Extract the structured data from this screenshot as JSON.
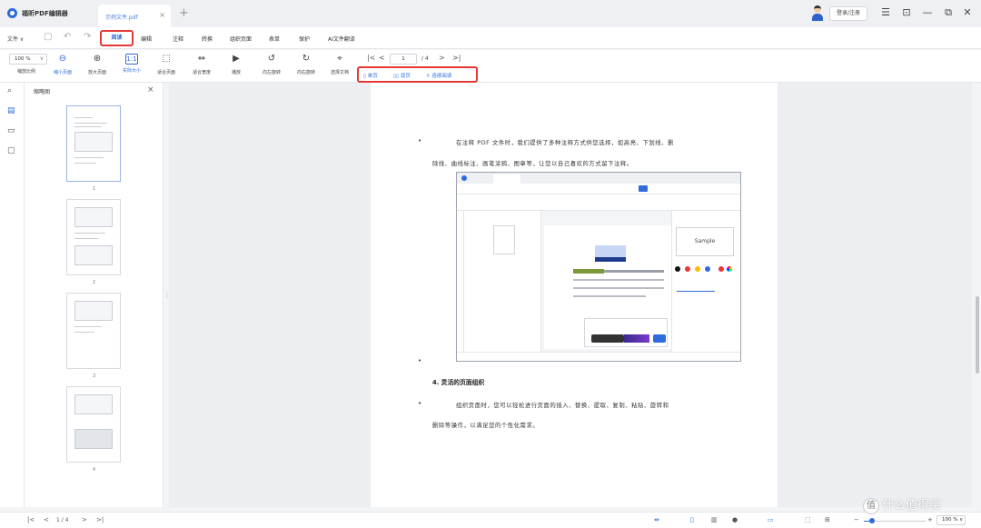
{
  "titlebar": {
    "app_name": "福昕PDF编辑器",
    "tab_name": "示例文件.pdf",
    "tab_close": "×",
    "new_tab": "+",
    "login_label": "登录/注册",
    "icons": [
      "menu-icon",
      "restore-icon",
      "minimize-icon",
      "tile-icon",
      "close-icon"
    ],
    "controls": [
      "☰",
      "⊡",
      "—",
      "⧉",
      "✕"
    ]
  },
  "menubar": {
    "file_label": "文件",
    "items": [
      "阅读",
      "编辑",
      "注释",
      "转换",
      "组织页面",
      "表单",
      "保护",
      "AI文件翻译"
    ],
    "active_item": "阅读"
  },
  "toolbar": {
    "zoom_value": "100 %",
    "zoom_arrow": "∨",
    "page_current": "1",
    "page_total": "/ 4",
    "tools": [
      {
        "label": "缩放比例",
        "icon": "zoom-icon",
        "glyph": "↕"
      },
      {
        "label": "缩小页面",
        "icon": "zoom-out-icon",
        "glyph": "⊖"
      },
      {
        "label": "放大页面",
        "icon": "zoom-in-icon",
        "glyph": "⊕"
      },
      {
        "label": "实际大小",
        "icon": "actual-size-icon",
        "glyph": "1:1"
      },
      {
        "label": "适合页面",
        "icon": "fit-page-icon",
        "glyph": "⬚"
      },
      {
        "label": "适合宽度",
        "icon": "fit-width-icon",
        "glyph": "⇔"
      },
      {
        "label": "播放",
        "icon": "play-icon",
        "glyph": "▶"
      },
      {
        "label": "向左旋转",
        "icon": "rotate-left-icon",
        "glyph": "↺"
      },
      {
        "label": "向右旋转",
        "icon": "rotate-right-icon",
        "glyph": "↻"
      },
      {
        "label": "选择文档",
        "icon": "select-document-icon",
        "glyph": "⌖"
      }
    ],
    "view_modes": [
      {
        "label": "单页",
        "icon": "single-page-icon"
      },
      {
        "label": "双页",
        "icon": "two-page-icon"
      },
      {
        "label": "连续阅读",
        "icon": "continuous-icon"
      }
    ]
  },
  "thumbnails": {
    "title": "缩略图",
    "close": "×",
    "pages": [
      "1",
      "2",
      "3",
      "4"
    ]
  },
  "document": {
    "para1_line1": "在注释 PDF 文件时，我们提供了多种注释方式供您选择，如高亮、下划线、删",
    "para1_line2": "除线、曲线标注、画笔涂鸦、图章等，让您以自己喜欢的方式留下注释。",
    "heading": "4. 灵活的页面组织",
    "para2_line1": "组织页面时，您可以轻松进行页面的插入、替换、提取、复制、粘贴、旋转和",
    "para2_line2": "删除等操作，以满足您的个性化需求。",
    "bullet": "•",
    "embed": {
      "sample_label": "Sample"
    }
  },
  "statusbar": {
    "page_indicator": "1 / 4",
    "zoom_value": "100 %",
    "minus": "−",
    "plus": "+"
  },
  "watermark": {
    "text": "什么值得买",
    "icon": "值"
  },
  "colors": {
    "accent": "#2f6bdc",
    "highlight_box": "#e53935"
  }
}
